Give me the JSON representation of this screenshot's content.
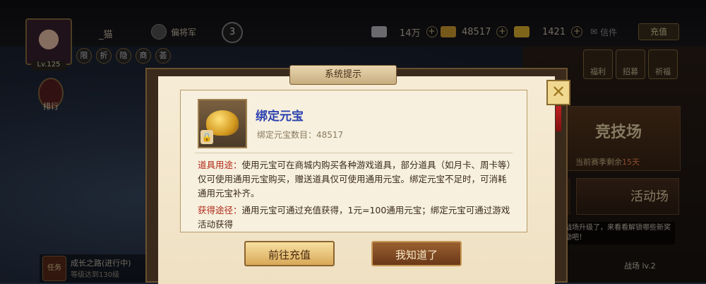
{
  "player": {
    "name": "_猫",
    "level": "Lv.125",
    "rank_title": "偏将军",
    "vip_level": "3"
  },
  "currencies": [
    {
      "icon": "silver-icon",
      "value": "14万",
      "color": "#c0c0c8"
    },
    {
      "icon": "bound-ingot-icon",
      "value": "48517",
      "color": "#d8a030"
    },
    {
      "icon": "ingot-icon",
      "value": "1421",
      "color": "#e8b830"
    }
  ],
  "header": {
    "mail_label": "信件",
    "recharge_label": "充值"
  },
  "quick_circles": [
    "限",
    "折",
    "隐",
    "商",
    "荟"
  ],
  "left_side": {
    "ranking_label": "排行"
  },
  "right_buttons": [
    "福利",
    "招募",
    "祈福"
  ],
  "arena": {
    "title": "竞技场",
    "season_prefix": "当前赛季剩余",
    "season_days": "15天"
  },
  "activity": {
    "title": "活动场",
    "left_label": "场"
  },
  "battlefield": {
    "tip": "战场升级了，来看看解锁哪些新奖励吧！",
    "level": "战场 lv.2"
  },
  "task": {
    "icon_label": "任务",
    "line1": "成长之路(进行中)",
    "line2": "等级达到130级"
  },
  "dialog": {
    "title": "系统提示",
    "close_symbol": "✕",
    "item_name": "绑定元宝",
    "item_count_label": "绑定元宝数目：",
    "item_count": "48517",
    "usage_key": "道具用途：",
    "usage_text": "使用元宝可在商城内购买各种游戏道具，部分道具（如月卡、周卡等）仅可使用通用元宝购买，赠送道具仅可使用通用元宝。绑定元宝不足时，可消耗通用元宝补齐。",
    "source_key": "获得途径：",
    "source_text": "通用元宝可通过充值获得，1元=100通用元宝；绑定元宝可通过游戏活动获得",
    "btn_recharge": "前往充值",
    "btn_ok": "我知道了"
  }
}
